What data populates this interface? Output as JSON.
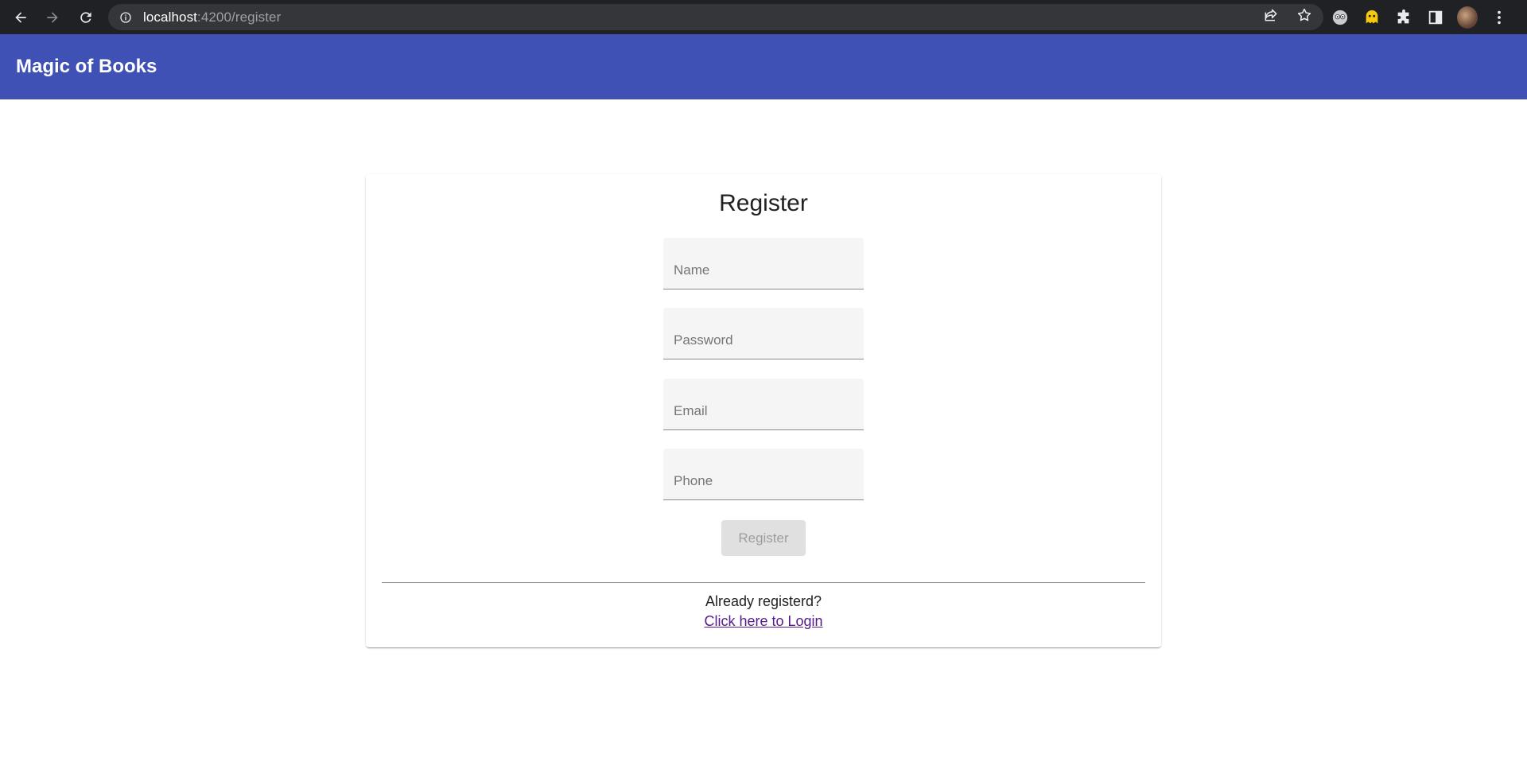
{
  "browser": {
    "url_host": "localhost",
    "url_path": ":4200/register",
    "icons": [
      "back-icon",
      "forward-icon",
      "reload-icon",
      "info-icon",
      "share-icon",
      "star-icon",
      "extension-icon",
      "puzzle-icon",
      "sidepanel-icon",
      "menu-icon"
    ]
  },
  "toolbar": {
    "title": "Magic of Books",
    "color": "#3f51b5"
  },
  "register": {
    "title": "Register",
    "fields": {
      "name": {
        "placeholder": "Name",
        "value": ""
      },
      "password": {
        "placeholder": "Password",
        "value": ""
      },
      "email": {
        "placeholder": "Email",
        "value": ""
      },
      "phone": {
        "placeholder": "Phone",
        "value": ""
      }
    },
    "submit_label": "Register",
    "submit_disabled": true,
    "already_text": "Already registerd?",
    "login_link": "Click here to Login"
  }
}
